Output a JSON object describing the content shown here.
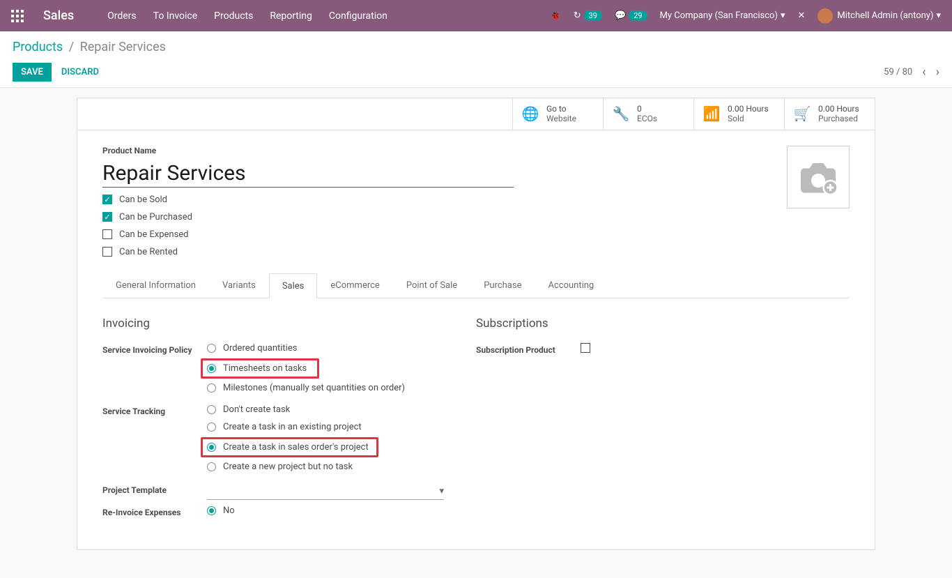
{
  "navbar": {
    "brand": "Sales",
    "menu": [
      "Orders",
      "To Invoice",
      "Products",
      "Reporting",
      "Configuration"
    ],
    "badge1": "39",
    "badge2": "29",
    "company": "My Company (San Francisco)",
    "user": "Mitchell Admin (antony)"
  },
  "breadcrumb": {
    "root": "Products",
    "current": "Repair Services"
  },
  "buttons": {
    "save": "SAVE",
    "discard": "DISCARD"
  },
  "pager": {
    "text": "59 / 80"
  },
  "stats": {
    "website_l1": "Go to",
    "website_l2": "Website",
    "ecos_l1": "0",
    "ecos_l2": "ECOs",
    "sold_l1": "0.00 Hours",
    "sold_l2": "Sold",
    "purch_l1": "0.00 Hours",
    "purch_l2": "Purchased"
  },
  "product": {
    "name_label": "Product Name",
    "name": "Repair Services",
    "can_sold": "Can be Sold",
    "can_purchased": "Can be Purchased",
    "can_expensed": "Can be Expensed",
    "can_rented": "Can be Rented"
  },
  "tabs": [
    "General Information",
    "Variants",
    "Sales",
    "eCommerce",
    "Point of Sale",
    "Purchase",
    "Accounting"
  ],
  "sales": {
    "invoicing_title": "Invoicing",
    "subscriptions_title": "Subscriptions",
    "service_policy_label": "Service Invoicing Policy",
    "policy_opts": [
      "Ordered quantities",
      "Timesheets on tasks",
      "Milestones (manually set quantities on order)"
    ],
    "service_tracking_label": "Service Tracking",
    "tracking_opts": [
      "Don't create task",
      "Create a task in an existing project",
      "Create a task in sales order's project",
      "Create a new project but no task"
    ],
    "project_template_label": "Project Template",
    "reinvoice_label": "Re-Invoice Expenses",
    "reinvoice_opt1": "No",
    "subscription_product_label": "Subscription Product"
  }
}
